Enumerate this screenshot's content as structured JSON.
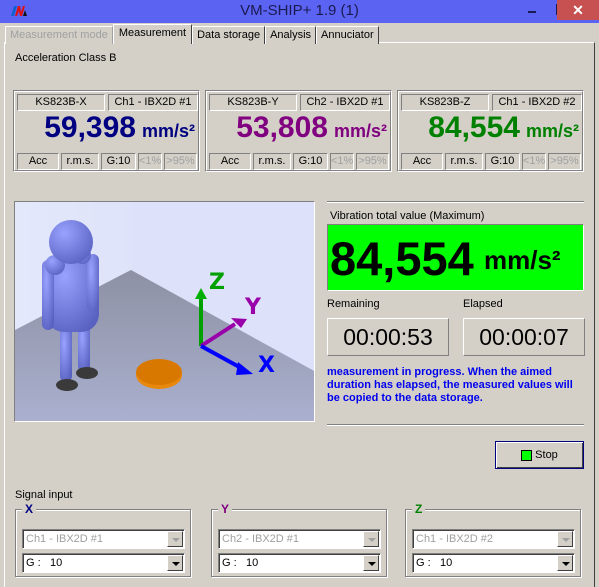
{
  "window": {
    "title": "VM-SHIP+ 1.9 (1)",
    "logo": "VM",
    "controls": {
      "minimize": "–",
      "maximize": "□",
      "close": "✕"
    }
  },
  "tabs": [
    {
      "label": "Measurement mode",
      "state": "disabled"
    },
    {
      "label": "Measurement",
      "state": "active"
    },
    {
      "label": "Data storage",
      "state": "normal"
    },
    {
      "label": "Analysis",
      "state": "normal"
    },
    {
      "label": "Annuciator",
      "state": "normal"
    }
  ],
  "class_label": "Acceleration Class B",
  "sensors": [
    {
      "name": "KS823B-X",
      "channel": "Ch1 - IBX2D #1",
      "value": "59,398",
      "unit": "mm/s²",
      "color": "#000080",
      "type": "Acc",
      "mode": "r.m.s.",
      "gain": "G:10",
      "low": "<1%",
      "high": ">95%"
    },
    {
      "name": "KS823B-Y",
      "channel": "Ch2 - IBX2D #1",
      "value": "53,808",
      "unit": "mm/s²",
      "color": "#800080",
      "type": "Acc",
      "mode": "r.m.s.",
      "gain": "G:10",
      "low": "<1%",
      "high": ">95%"
    },
    {
      "name": "KS823B-Z",
      "channel": "Ch1 - IBX2D #2",
      "value": "84,554",
      "unit": "mm/s²",
      "color": "#008000",
      "type": "Acc",
      "mode": "r.m.s.",
      "gain": "G:10",
      "low": "<1%",
      "high": ">95%"
    }
  ],
  "scene": {
    "axis_labels": {
      "x": "X",
      "y": "Y",
      "z": "Z"
    },
    "axis_colors": {
      "x": "#0000ff",
      "y": "#9900aa",
      "z": "#00a000"
    }
  },
  "total": {
    "label": "Vibration total value (Maximum)",
    "value": "84,554",
    "unit": "mm/s²",
    "bg_color": "#00ff00"
  },
  "timers": {
    "remaining_label": "Remaining",
    "remaining": "00:00:53",
    "elapsed_label": "Elapsed",
    "elapsed": "00:00:07"
  },
  "status_message": "measurement in progress. When the aimed duration has elapsed, the measured values will be copied to the data storage.",
  "stop_button": {
    "label": "Stop",
    "led_color": "#00ff00"
  },
  "signal_input": {
    "label": "Signal input",
    "groups": [
      {
        "axis": "X",
        "color": "#000080",
        "channel": "Ch1 - IBX2D #1",
        "gain_label": "G :",
        "gain": "10"
      },
      {
        "axis": "Y",
        "color": "#800080",
        "channel": "Ch2 - IBX2D #1",
        "gain_label": "G :",
        "gain": "10"
      },
      {
        "axis": "Z",
        "color": "#008000",
        "channel": "Ch1 - IBX2D #2",
        "gain_label": "G :",
        "gain": "10"
      }
    ]
  }
}
